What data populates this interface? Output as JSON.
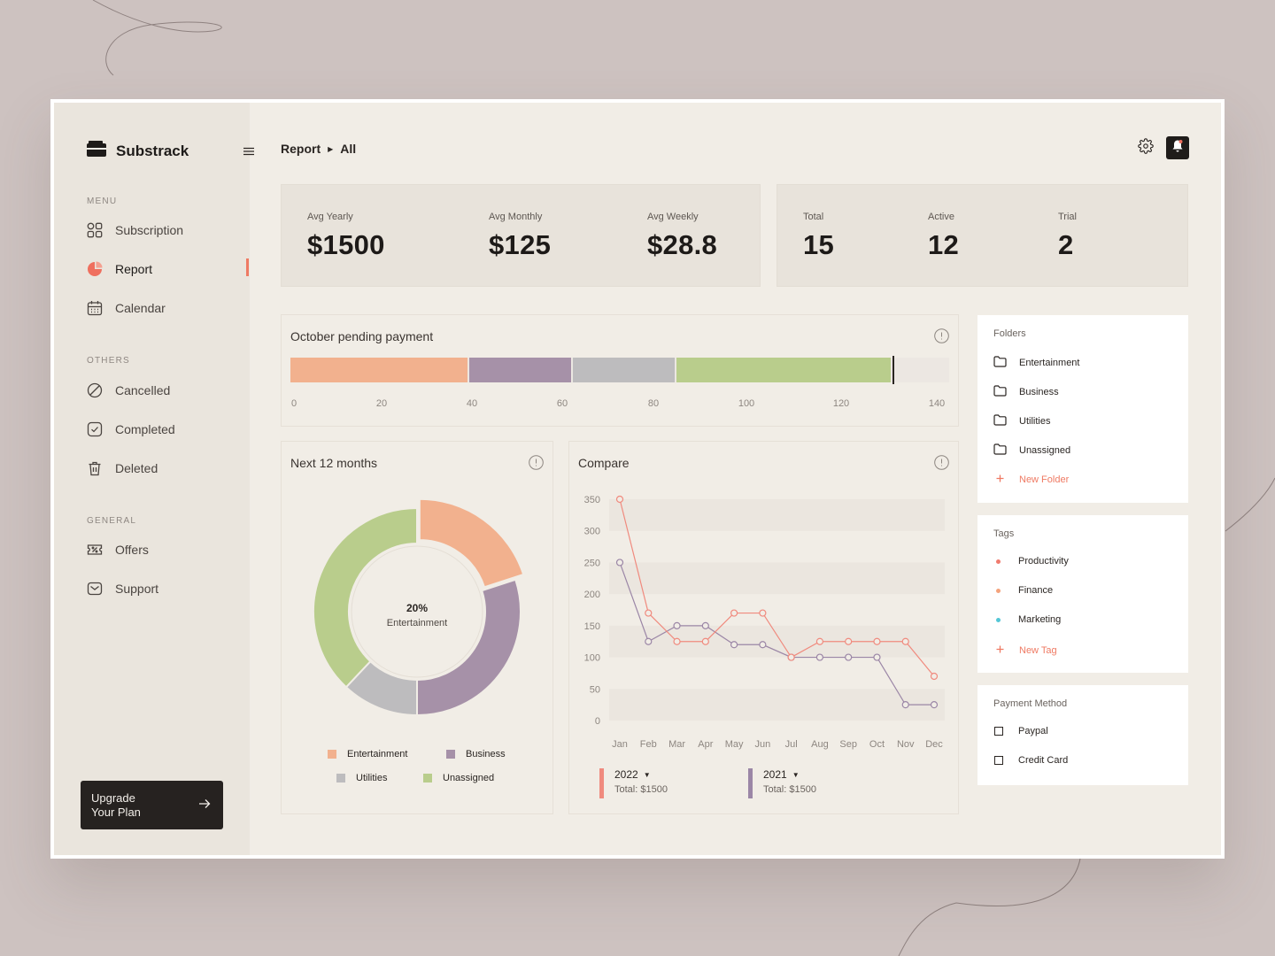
{
  "app": {
    "name": "Substrack"
  },
  "sidebar": {
    "sections": {
      "menu": "MENU",
      "others": "OTHERS",
      "general": "GENERAL"
    },
    "menu_items": [
      {
        "label": "Subscription",
        "icon": "grid-icon"
      },
      {
        "label": "Report",
        "icon": "pie-chart-icon",
        "active": true
      },
      {
        "label": "Calendar",
        "icon": "calendar-icon"
      }
    ],
    "other_items": [
      {
        "label": "Cancelled",
        "icon": "cancel-icon"
      },
      {
        "label": "Completed",
        "icon": "check-box-icon"
      },
      {
        "label": "Deleted",
        "icon": "trash-icon"
      }
    ],
    "general_items": [
      {
        "label": "Offers",
        "icon": "ticket-icon"
      },
      {
        "label": "Support",
        "icon": "mail-icon"
      }
    ],
    "upgrade": {
      "line1": "Upgrade",
      "line2": "Your Plan"
    }
  },
  "header": {
    "breadcrumb": [
      "Report",
      "All"
    ]
  },
  "stats": {
    "avg": [
      {
        "label": "Avg Yearly",
        "value": "$1500"
      },
      {
        "label": "Avg Monthly",
        "value": "$125"
      },
      {
        "label": "Avg Weekly",
        "value": "$28.8"
      }
    ],
    "counts": [
      {
        "label": "Total",
        "value": "15"
      },
      {
        "label": "Active",
        "value": "12"
      },
      {
        "label": "Trial",
        "value": "2"
      }
    ]
  },
  "pending": {
    "title": "October pending payment",
    "ticks": [
      "0",
      "20",
      "40",
      "60",
      "80",
      "100",
      "120",
      "140"
    ]
  },
  "donut": {
    "title": "Next 12 months",
    "center_pct": "20%",
    "center_label": "Entertainment",
    "legend": [
      "Entertainment",
      "Business",
      "Utilities",
      "Unassigned"
    ]
  },
  "compare": {
    "title": "Compare",
    "years": [
      {
        "year": "2022",
        "total": "Total: $1500",
        "color": "#f08a7e"
      },
      {
        "year": "2021",
        "total": "Total: $1500",
        "color": "#9b86a6"
      }
    ]
  },
  "folders": {
    "title": "Folders",
    "items": [
      "Entertainment",
      "Business",
      "Utilities",
      "Unassigned"
    ],
    "add_label": "New Folder"
  },
  "tags": {
    "title": "Tags",
    "items": [
      {
        "label": "Productivity",
        "color": "#f07b6e"
      },
      {
        "label": "Finance",
        "color": "#f4a37c"
      },
      {
        "label": "Marketing",
        "color": "#54c6d6"
      }
    ],
    "add_label": "New Tag"
  },
  "payment": {
    "title": "Payment Method",
    "items": [
      "Paypal",
      "Credit Card"
    ]
  },
  "chart_data": [
    {
      "type": "bar",
      "title": "October pending payment",
      "orientation": "horizontal-stacked",
      "categories": [
        "Entertainment",
        "Business",
        "Utilities",
        "Unassigned"
      ],
      "values": [
        38,
        22,
        22,
        46
      ],
      "colors": [
        "#f2b18e",
        "#a691a8",
        "#bdbcbe",
        "#b9cd8c"
      ],
      "xlim": [
        0,
        140
      ],
      "marker": 128
    },
    {
      "type": "pie",
      "title": "Next 12 months",
      "style": "donut",
      "categories": [
        "Entertainment",
        "Business",
        "Utilities",
        "Unassigned"
      ],
      "values": [
        20,
        30,
        12,
        38
      ],
      "colors": [
        "#f2b18e",
        "#a691a8",
        "#bdbcbe",
        "#b9cd8c"
      ],
      "highlighted": "Entertainment"
    },
    {
      "type": "line",
      "title": "Compare",
      "x": [
        "Jan",
        "Feb",
        "Mar",
        "Apr",
        "May",
        "Jun",
        "Jul",
        "Aug",
        "Sep",
        "Oct",
        "Nov",
        "Dec"
      ],
      "ylim": [
        0,
        350
      ],
      "yticks": [
        0,
        50,
        100,
        150,
        200,
        250,
        300,
        350
      ],
      "series": [
        {
          "name": "2022",
          "color": "#f08a7e",
          "values": [
            350,
            170,
            125,
            125,
            170,
            170,
            100,
            125,
            125,
            125,
            125,
            70
          ]
        },
        {
          "name": "2021",
          "color": "#9b86a6",
          "values": [
            250,
            125,
            150,
            150,
            120,
            120,
            100,
            100,
            100,
            100,
            25,
            25
          ]
        }
      ]
    }
  ]
}
